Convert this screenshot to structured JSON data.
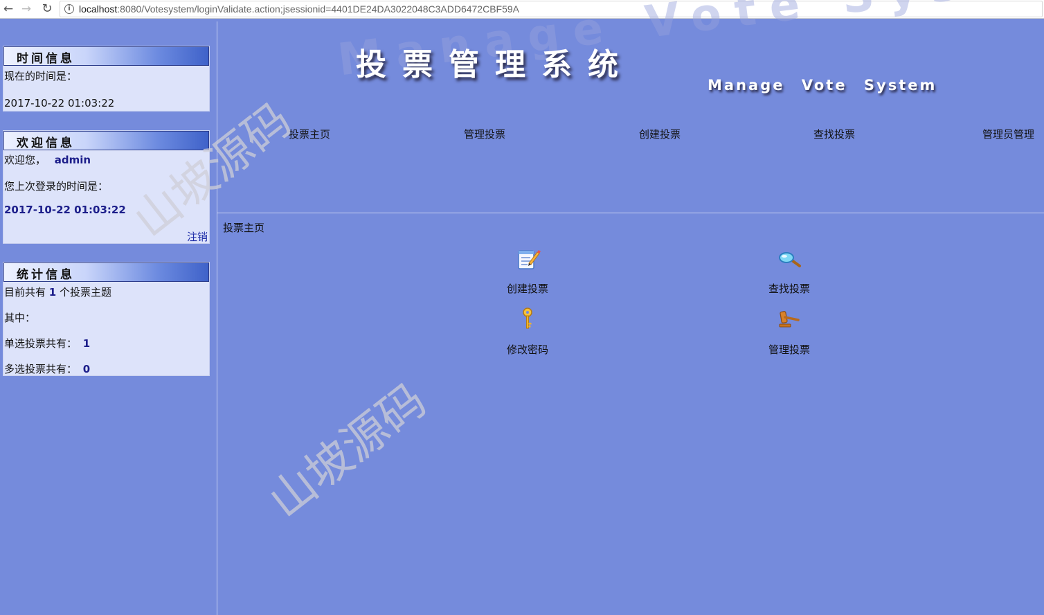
{
  "browser": {
    "back_icon": "←",
    "forward_icon": "→",
    "reload_icon": "↻",
    "url_host": "localhost",
    "url_rest": ":8080/Votesystem/loginValidate.action;jsessionid=4401DE24DA3022048C3ADD6472CBF59A"
  },
  "sidebar": {
    "time_panel": {
      "title": "时间信息",
      "label": "现在的时间是：",
      "current_time": "2017-10-22 01:03:22"
    },
    "welcome_panel": {
      "title": "欢迎信息",
      "greeting": "欢迎您，",
      "username": "admin",
      "last_login_label": "您上次登录的时间是：",
      "last_login_time": "2017-10-22 01:03:22",
      "logout": "注销"
    },
    "stats_panel": {
      "title": "统计信息",
      "total_prefix": "目前共有",
      "total_count": "1",
      "total_suffix": "个投票主题",
      "among_label": "其中：",
      "single_label": "单选投票共有：",
      "single_count": "1",
      "multi_label": "多选投票共有：",
      "multi_count": "0"
    }
  },
  "header": {
    "title_cn": "投票管理系统",
    "title_en": "Manage Vote System",
    "nav": [
      "投票主页",
      "管理投票",
      "创建投票",
      "查找投票",
      "管理员管理"
    ]
  },
  "main": {
    "page_label": "投票主页",
    "actions": [
      {
        "label": "创建投票",
        "icon": "edit-document-icon"
      },
      {
        "label": "查找投票",
        "icon": "magnifier-icon"
      },
      {
        "label": "修改密码",
        "icon": "key-icon"
      },
      {
        "label": "管理投票",
        "icon": "gavel-icon"
      }
    ]
  },
  "watermark": "山坡源码",
  "colors": {
    "background": "#758bdc",
    "panel_bg": "#dde3fa",
    "highlight": "#1c1e8a"
  }
}
